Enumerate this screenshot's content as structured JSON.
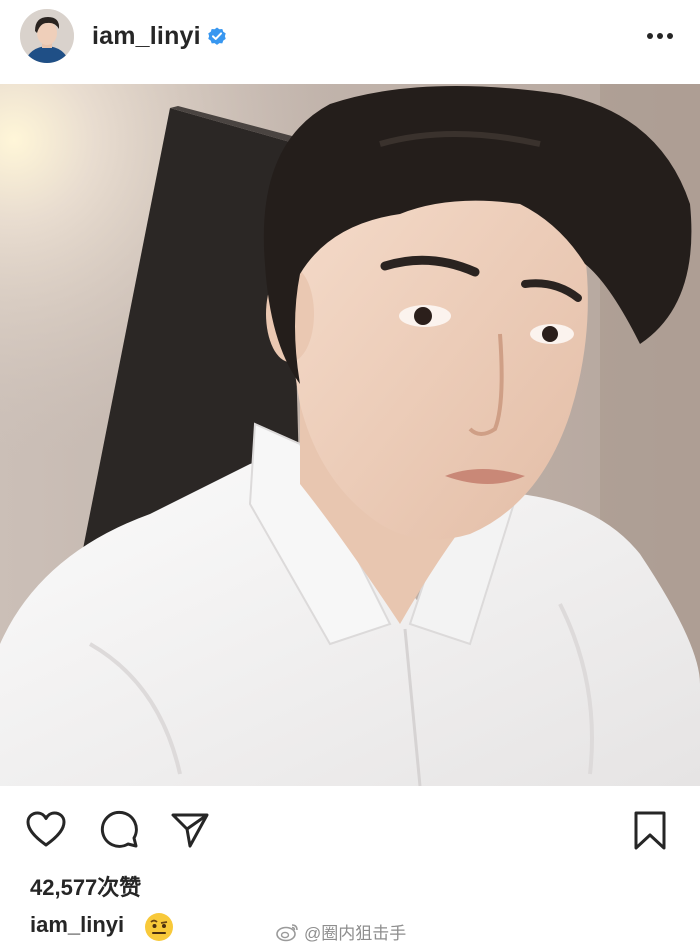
{
  "header": {
    "username": "iam_linyi",
    "verified_icon": "verified-badge-icon",
    "more_icon": "more-options-icon",
    "verified_color": "#3897f0"
  },
  "post": {
    "image_alt": "Selfie photo",
    "like_icon": "heart-icon",
    "comment_icon": "comment-icon",
    "share_icon": "share-icon",
    "save_icon": "bookmark-icon",
    "likes_text": "42,577次赞",
    "caption_username": "iam_linyi",
    "caption_emoji": "raised-eyebrow-emoji"
  },
  "watermark": {
    "logo_icon": "weibo-logo-icon",
    "text": "@圈内狙击手"
  }
}
